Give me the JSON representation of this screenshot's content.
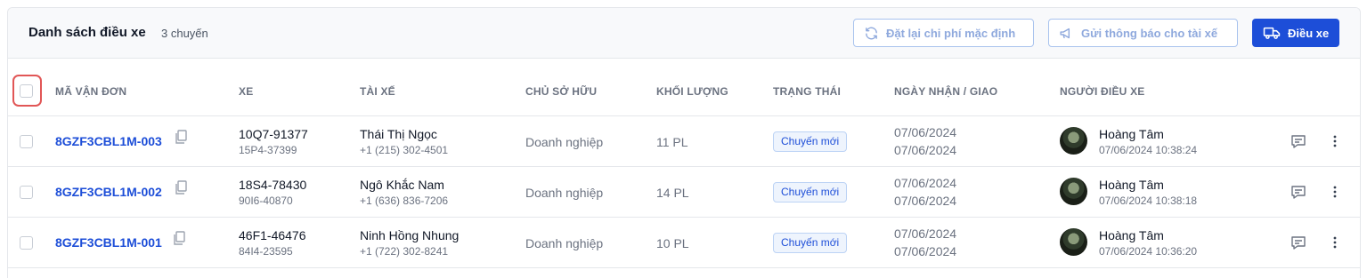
{
  "header": {
    "title": "Danh sách điều xe",
    "count": "3 chuyến",
    "reset_button": "Đặt lại chi phí mặc định",
    "notify_button": "Gửi thông báo cho tài xế",
    "dispatch_button": "Điều xe"
  },
  "columns": {
    "code": "MÃ VẬN ĐƠN",
    "vehicle": "XE",
    "driver": "TÀI XẾ",
    "owner": "CHỦ SỞ HỮU",
    "weight": "KHỐI LƯỢNG",
    "status": "TRẠNG THÁI",
    "dates": "NGÀY NHẬN / GIAO",
    "dispatcher": "NGƯỜI ĐIỀU XE"
  },
  "rows": [
    {
      "code": "8GZF3CBL1M-003",
      "plate": "10Q7-91377",
      "trailer": "15P4-37399",
      "driver": "Thái Thị Ngọc",
      "phone": "+1 (215) 302-4501",
      "owner": "Doanh nghiệp",
      "weight": "11 PL",
      "status": "Chuyến mới",
      "pickup": "07/06/2024",
      "delivery": "07/06/2024",
      "dispatcher": "Hoàng Tâm",
      "dispatched_at": "07/06/2024 10:38:24"
    },
    {
      "code": "8GZF3CBL1M-002",
      "plate": "18S4-78430",
      "trailer": "90I6-40870",
      "driver": "Ngô Khắc Nam",
      "phone": "+1 (636) 836-7206",
      "owner": "Doanh nghiệp",
      "weight": "14 PL",
      "status": "Chuyến mới",
      "pickup": "07/06/2024",
      "delivery": "07/06/2024",
      "dispatcher": "Hoàng Tâm",
      "dispatched_at": "07/06/2024 10:38:18"
    },
    {
      "code": "8GZF3CBL1M-001",
      "plate": "46F1-46476",
      "trailer": "84I4-23595",
      "driver": "Ninh Hồng Nhung",
      "phone": "+1 (722) 302-8241",
      "owner": "Doanh nghiệp",
      "weight": "10 PL",
      "status": "Chuyến mới",
      "pickup": "07/06/2024",
      "delivery": "07/06/2024",
      "dispatcher": "Hoàng Tâm",
      "dispatched_at": "07/06/2024 10:36:20"
    }
  ],
  "icons": {
    "reset": "refresh-icon",
    "notify": "megaphone-icon",
    "dispatch": "truck-icon",
    "copy": "copy-icon",
    "comment": "comment-icon",
    "more": "more-vertical-icon"
  },
  "colors": {
    "accent": "#1d4ed8",
    "highlight": "#e15656",
    "badge_bg": "#eef4fd"
  }
}
